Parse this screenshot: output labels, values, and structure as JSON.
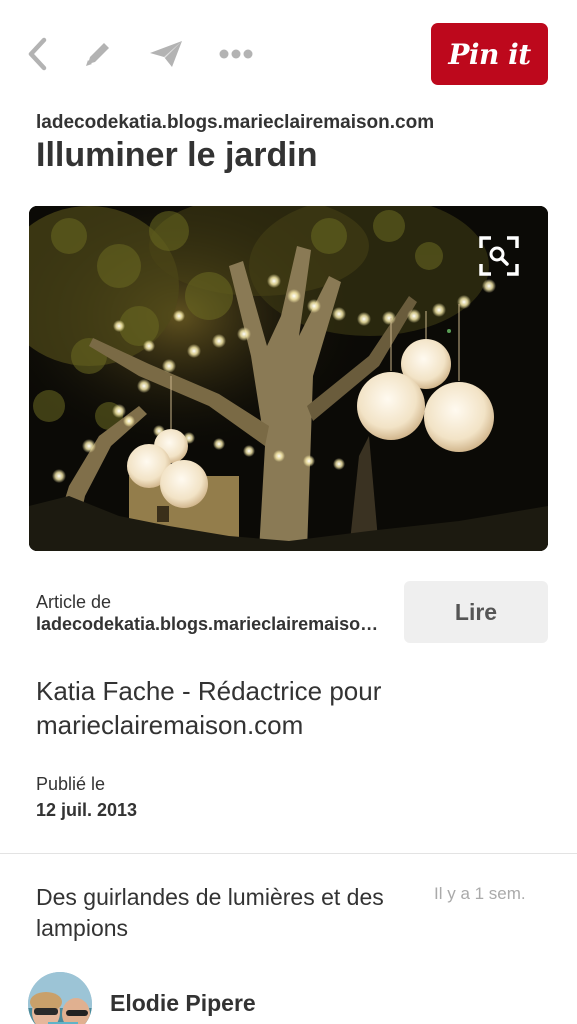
{
  "toolbar": {
    "icons": {
      "back": "chevron-left-icon",
      "edit": "pencil-icon",
      "send": "paper-plane-icon",
      "more": "ellipsis-icon"
    },
    "pin_button_label": "Pin it",
    "pin_button_color": "#bd081c"
  },
  "pin": {
    "source_domain": "ladecodekatia.blogs.marieclairemaison.com",
    "title": "Illuminer le jardin",
    "image": {
      "zoom_icon": "visual-search-icon"
    }
  },
  "article": {
    "label": "Article de",
    "domain": "ladecodekatia.blogs.marieclairemaison.com",
    "read_button": "Lire"
  },
  "author": "Katia Fache - Rédactrice pour marieclairemaison.com",
  "published": {
    "label": "Publié le",
    "date": "12 juil. 2013"
  },
  "comment": {
    "description": "Des guirlandes de lumières et des lampions",
    "timestamp": "Il y a 1 sem."
  },
  "user": {
    "name": "Elodie Pipere"
  }
}
